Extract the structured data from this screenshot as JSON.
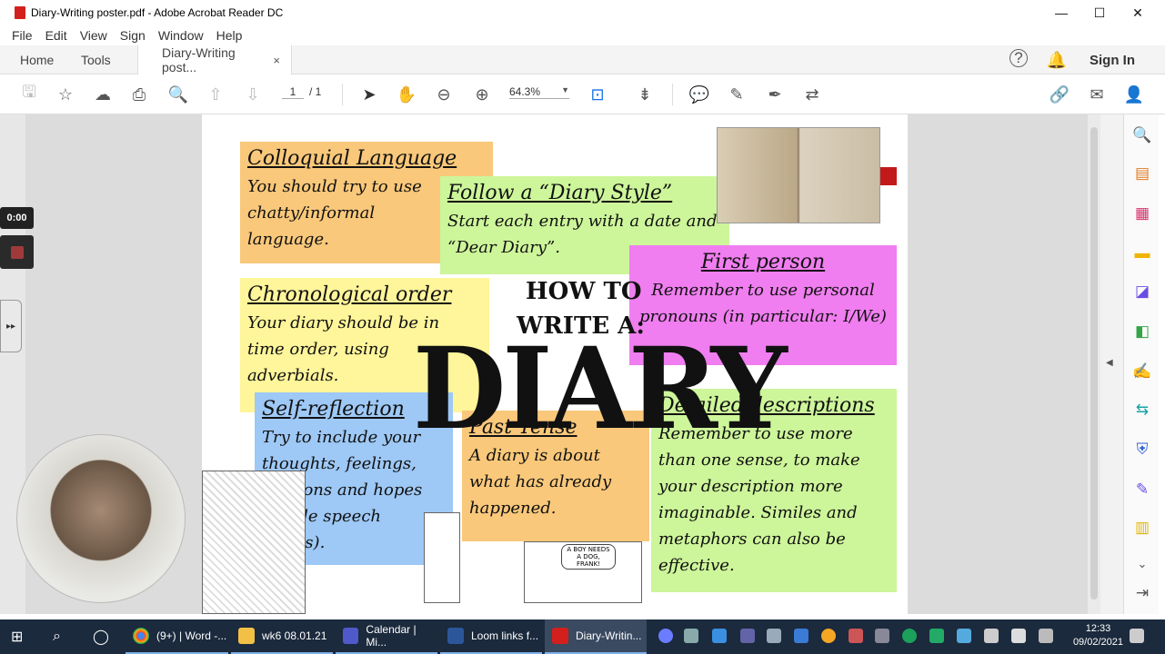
{
  "window": {
    "title": "Diary-Writing poster.pdf - Adobe Acrobat Reader DC"
  },
  "menu": [
    "File",
    "Edit",
    "View",
    "Sign",
    "Window",
    "Help"
  ],
  "tabs": {
    "home": "Home",
    "tools": "Tools",
    "doc": "Diary-Writing post...",
    "close": "×"
  },
  "header_right": {
    "sign_in": "Sign In"
  },
  "toolbar": {
    "page_current": "1",
    "page_total": "/ 1",
    "zoom": "64.3%"
  },
  "poster": {
    "colloquial": {
      "heading": "Colloquial Language",
      "body": "You should try to use chatty/informal language."
    },
    "diary_style": {
      "heading": "Follow a “Diary Style”",
      "body": "Start each entry with a date and “Dear Diary”."
    },
    "first_person": {
      "heading": "First person",
      "body": "Remember to use personal pronouns (in particular: I/We)"
    },
    "chronological": {
      "heading": "Chronological order",
      "body": "Your diary should be in time order, using adverbials."
    },
    "how_to": "HOW TO",
    "write_a": "WRITE A:",
    "diary": "DIARY",
    "self_reflection": {
      "heading": "Self-reflection",
      "body": "Try to include your thoughts, feelings, opinions and hopes (inside speech marks)."
    },
    "past_tense": {
      "heading": "Past Tense",
      "body": "A diary is about what has already happened."
    },
    "detailed": {
      "heading": "Detailed descriptions",
      "body": "Remember to use more than one sense, to make your description more imaginable. Similes and metaphors can also be effective."
    },
    "comic_bubble": "A BOY NEEDS A DOG, FRANK!"
  },
  "recorder": {
    "timer": "0:00"
  },
  "taskbar": {
    "items": [
      "(9+) | Word -...",
      "wk6 08.01.21",
      "Calendar | Mi...",
      "Loom links f...",
      "Diary-Writin..."
    ],
    "time": "12:33",
    "date": "09/02/2021"
  },
  "colors": {
    "orange_note": "#f9c87a",
    "green_note": "#cdf59a",
    "pink_note": "#f07ef0",
    "yellow_note": "#fff59a",
    "blue_note": "#9ec8f5",
    "taskbar": "#1b2a3d",
    "acrobat_blue": "#1473e6"
  }
}
